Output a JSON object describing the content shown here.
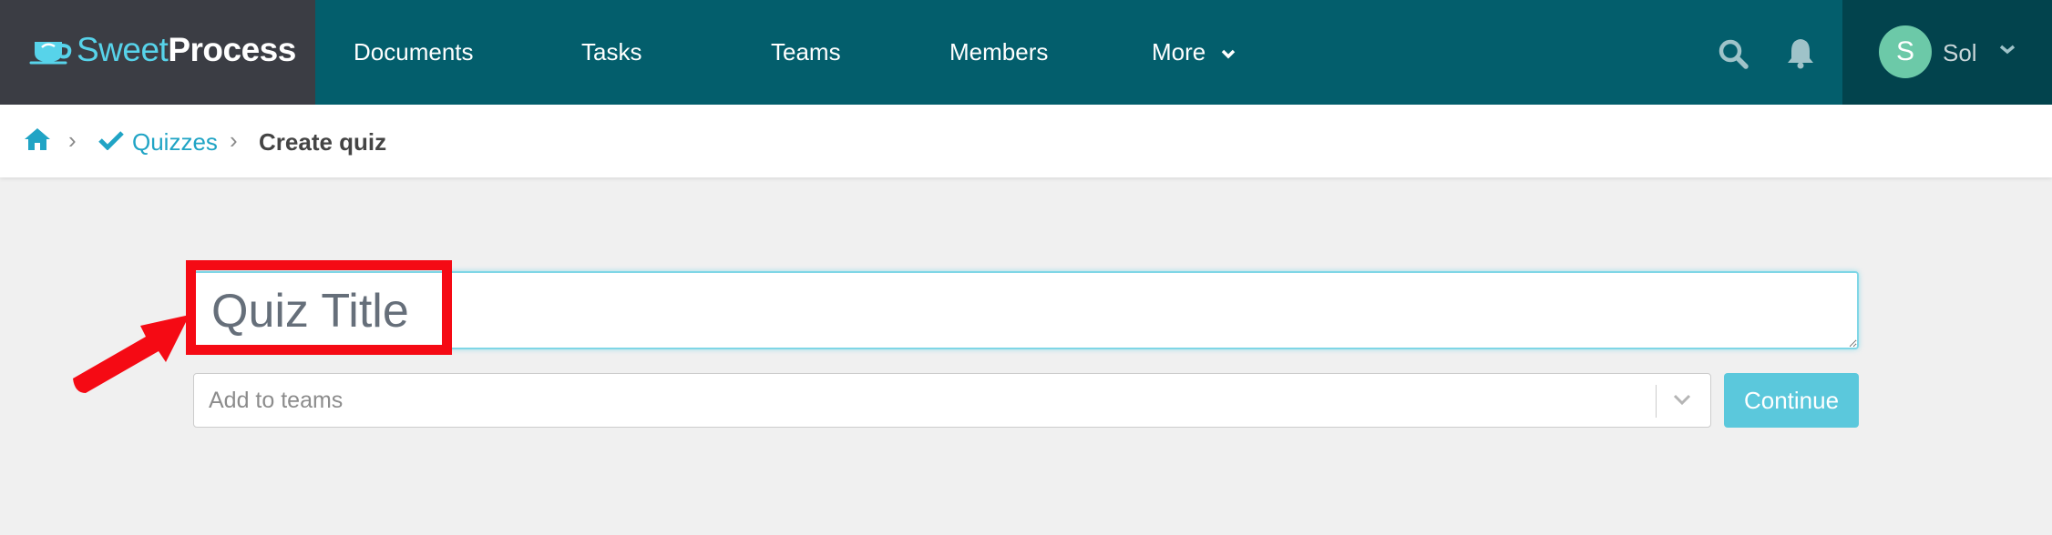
{
  "app": {
    "brand_sweet": "Sweet",
    "brand_process": "Process"
  },
  "nav": {
    "items": [
      {
        "label": "Documents"
      },
      {
        "label": "Tasks"
      },
      {
        "label": "Teams"
      },
      {
        "label": "Members"
      },
      {
        "label": "More"
      }
    ],
    "icons": [
      "search-icon",
      "bell-icon"
    ]
  },
  "user": {
    "initial": "S",
    "name": "Sol"
  },
  "breadcrumb": {
    "home_icon": "home-icon",
    "items": [
      {
        "label": "Quizzes",
        "icon": "check-icon"
      },
      {
        "label": "Create quiz"
      }
    ]
  },
  "form": {
    "title_placeholder": "Quiz Title",
    "title_value": "",
    "teams_placeholder": "Add to teams",
    "continue_label": "Continue"
  },
  "colors": {
    "nav_bg": "#035e6c",
    "brand_bg": "#3b3d44",
    "user_bg": "#02434d",
    "accent": "#57d3ea",
    "link": "#20a4c5",
    "button": "#5bc8dc",
    "annotation": "#f50a14"
  }
}
